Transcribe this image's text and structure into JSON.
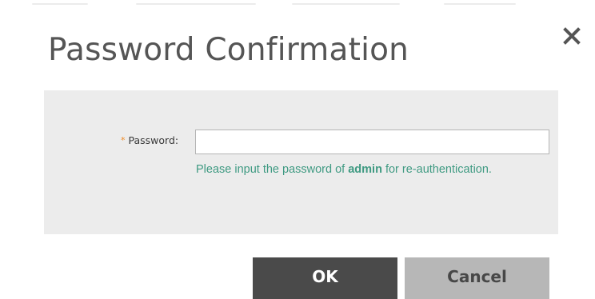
{
  "dialog": {
    "title": "Password Confirmation",
    "close_icon": "close-icon"
  },
  "form": {
    "required_marker": "*",
    "password_label": "Password:",
    "password_value": "",
    "help_prefix": "Please input the password of ",
    "help_user": "admin",
    "help_suffix": " for re-authentication."
  },
  "buttons": {
    "ok_label": "OK",
    "cancel_label": "Cancel"
  },
  "colors": {
    "title_text": "#555555",
    "panel_background": "#ececec",
    "required_marker": "#f08a24",
    "help_text": "#3f9a82",
    "ok_background": "#4a4a4a",
    "cancel_background": "#b7b7b7"
  }
}
